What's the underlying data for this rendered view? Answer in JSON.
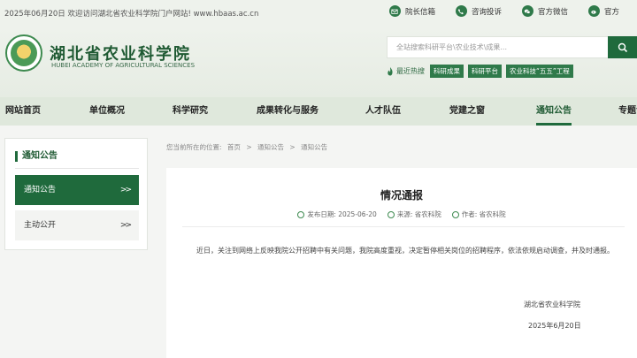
{
  "topbar": {
    "welcome": "2025年06月20日 欢迎访问湖北省农业科学院门户网站! www.hbaas.ac.cn",
    "links": [
      {
        "label": "院长信箱",
        "icon": "mail-icon"
      },
      {
        "label": "咨询投诉",
        "icon": "phone-icon"
      },
      {
        "label": "官方微信",
        "icon": "wechat-icon"
      },
      {
        "label": "官方",
        "icon": "weibo-icon"
      }
    ]
  },
  "header": {
    "name_cn": "湖北省农业科学院",
    "name_en": "HUBEI ACADEMY OF AGRICULTURAL SCIENCES",
    "search_placeholder": "全站搜索科研平台\\农业技术\\成果...",
    "hot_label": "最近热搜",
    "hot_tags": [
      "科研成果",
      "科研平台",
      "农业科技“五五”工程"
    ]
  },
  "nav": {
    "items": [
      "网站首页",
      "单位概况",
      "科学研究",
      "成果转化与服务",
      "人才队伍",
      "党建之窗",
      "通知公告",
      "专题专"
    ],
    "active_index": 6
  },
  "sidebar": {
    "title": "通知公告",
    "items": [
      {
        "label": "通知公告",
        "active": true,
        "chevron": ">>"
      },
      {
        "label": "主动公开",
        "active": false,
        "chevron": ">>"
      }
    ]
  },
  "breadcrumb": [
    "您当前所在的位置:",
    "首页",
    ">",
    "通知公告",
    ">",
    "通知公告"
  ],
  "article": {
    "title": "情况通报",
    "publish_label": "发布日期: 2025-06-20",
    "source_label": "来源: 省农科院",
    "author_label": "作者: 省农科院",
    "body": "近日，关注到网络上反映我院公开招聘中有关问题，我院高度重视，决定暂停相关岗位的招聘程序，依法依规启动调查，并及时通报。",
    "signature_org": "湖北省农业科学院",
    "signature_date": "2025年6月20日"
  },
  "colors": {
    "accent": "#1f6a3c",
    "nav_bg": "#dfe8dc"
  }
}
